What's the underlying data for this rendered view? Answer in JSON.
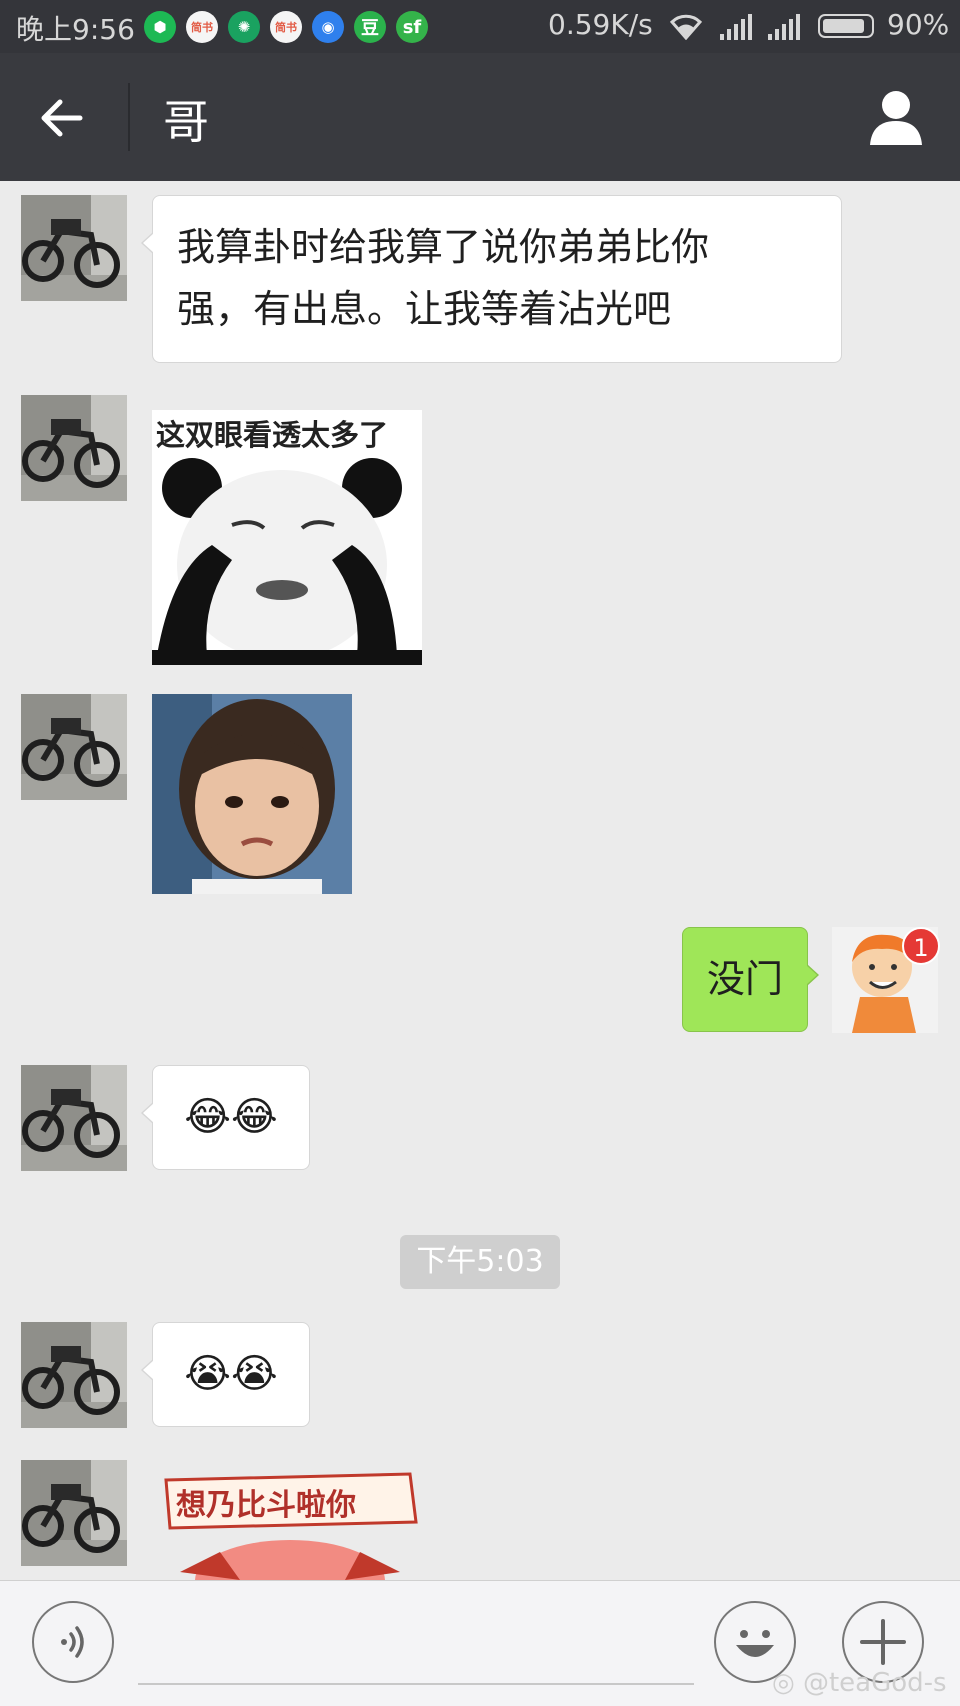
{
  "status_bar": {
    "time": "晚上9:56",
    "app_icons": [
      {
        "name": "shield-app-icon",
        "color": "#1db954",
        "glyph": "⬢"
      },
      {
        "name": "jianshu-app-icon",
        "color": "#f5f5f5",
        "glyph": "简书"
      },
      {
        "name": "leaf-app-icon",
        "color": "#1aa260",
        "glyph": "✺"
      },
      {
        "name": "jianshu-app-icon",
        "color": "#f5f5f5",
        "glyph": "简书"
      },
      {
        "name": "map-app-icon",
        "color": "#2f80ed",
        "glyph": "◉"
      },
      {
        "name": "douban-app-icon",
        "color": "#2bb24c",
        "glyph": "豆"
      },
      {
        "name": "sf-app-icon",
        "color": "#34b34a",
        "glyph": "sf"
      }
    ],
    "net_speed": "0.59K/s",
    "battery": "90%",
    "battery_level": 0.9
  },
  "nav": {
    "title": "哥"
  },
  "messages": [
    {
      "side": "left",
      "type": "text",
      "text_lines": [
        "我算卦时给我算了说你弟弟比你",
        "强，有出息。让我等着沾光吧"
      ]
    },
    {
      "side": "left",
      "type": "sticker",
      "caption": "这双眼看透太多了"
    },
    {
      "side": "left",
      "type": "photo"
    },
    {
      "side": "right",
      "type": "text",
      "text": "没门",
      "badge": "1"
    },
    {
      "side": "left",
      "type": "text",
      "text": "😂😂"
    },
    {
      "side": "left",
      "type": "text",
      "text": "😭😭"
    },
    {
      "side": "left",
      "type": "sticker",
      "caption": "想乃比斗啦你"
    }
  ],
  "timestamp": "下午5:03",
  "watermark": "@teaGod-s",
  "colors": {
    "nav_bg": "#393a3f",
    "chat_bg": "#ebebeb",
    "sent_bubble": "#9fe658",
    "received_bubble": "#ffffff"
  }
}
